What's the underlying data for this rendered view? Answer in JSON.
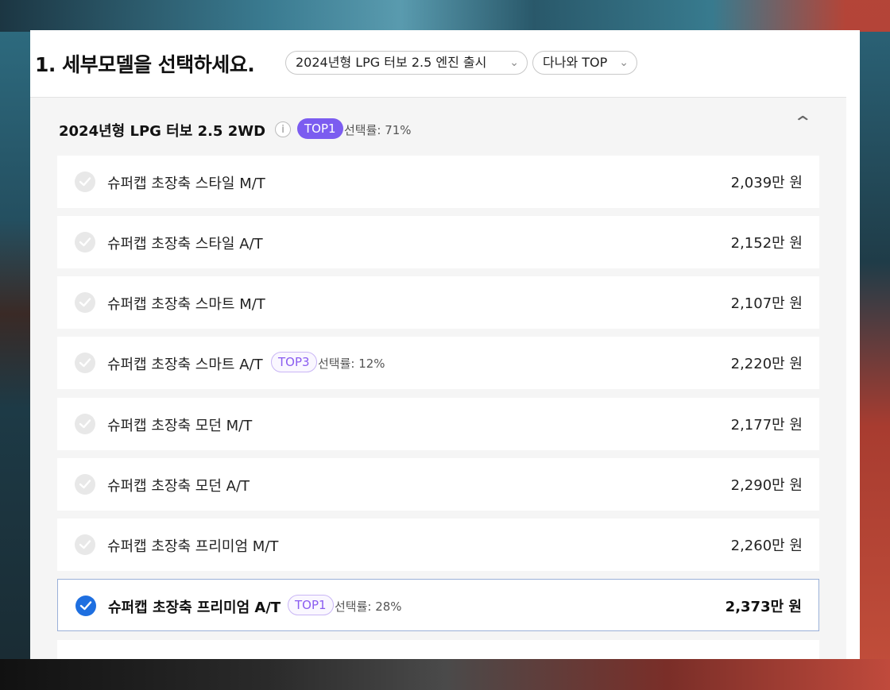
{
  "header": {
    "title": "1. 세부모델을 선택하세요.",
    "dropdown_engine": "2024년형 LPG 터보 2.5 엔진 출시",
    "dropdown_sort": "다나와 TOP"
  },
  "section": {
    "title": "2024년형 LPG 터보 2.5 2WD",
    "info_icon": "i",
    "badge": "TOP1",
    "rate": "선택률: 71%"
  },
  "items": [
    {
      "name": "슈퍼캡 초장축 스타일 M/T",
      "price": "2,039만 원",
      "selected": false
    },
    {
      "name": "슈퍼캡 초장축 스타일 A/T",
      "price": "2,152만 원",
      "selected": false
    },
    {
      "name": "슈퍼캡 초장축 스마트 M/T",
      "price": "2,107만 원",
      "selected": false
    },
    {
      "name": "슈퍼캡 초장축 스마트 A/T",
      "price": "2,220만 원",
      "selected": false,
      "badge": "TOP3",
      "rate": "선택률: 12%"
    },
    {
      "name": "슈퍼캡 초장축 모던 M/T",
      "price": "2,177만 원",
      "selected": false
    },
    {
      "name": "슈퍼캡 초장축 모던 A/T",
      "price": "2,290만 원",
      "selected": false
    },
    {
      "name": "슈퍼캡 초장축 프리미엄 M/T",
      "price": "2,260만 원",
      "selected": false
    },
    {
      "name": "슈퍼캡 초장축 프리미엄 A/T",
      "price": "2,373만 원",
      "selected": true,
      "badge": "TOP1",
      "rate": "선택률: 28%"
    }
  ],
  "colors": {
    "accent": "#7b5cf0",
    "selected_check": "#1e6fe0"
  }
}
